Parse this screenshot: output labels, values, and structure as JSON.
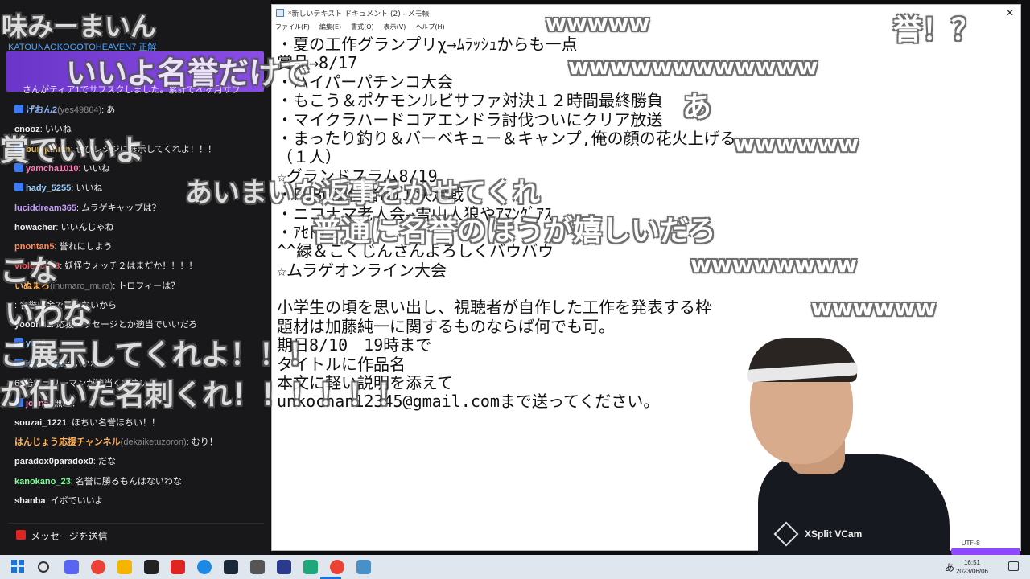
{
  "chat": {
    "top_name": "KATOUNAOKOGOTOHEAVEN7 正解",
    "sub_text": "さんがティア1でサブスクしました。累計で20ヶ月サブ",
    "messages": [
      {
        "user": "げおん2",
        "alt": "(yes49864)",
        "text": ": あ"
      },
      {
        "user": "cnooz",
        "alt": "",
        "text": ": いいね"
      },
      {
        "user": "bunijunian",
        "alt": "",
        "text": ": ぜひレシジに展示してくれよ！！！"
      },
      {
        "user": "yamcha1010",
        "alt": "",
        "text": ": いいね"
      },
      {
        "user": "hady_5255",
        "alt": "",
        "text": ": いいね"
      },
      {
        "user": "luciddream365",
        "alt": "",
        "text": ": ムラゲキャップは？"
      },
      {
        "user": "howacher",
        "alt": "",
        "text": ": いいんじゃね"
      },
      {
        "user": "pnontan5",
        "alt": "",
        "text": ": 誉れにしよう"
      },
      {
        "user": "violence63",
        "alt": "",
        "text": ": 妖怪ウォッチ２はまだか！！！！"
      },
      {
        "user": "いぬまろ",
        "alt": "(inumaro_mura)",
        "text": ": トロフィーは？"
      },
      {
        "user": "",
        "alt": "",
        "text": ": 名誉は金で買えないから"
      },
      {
        "user": "yooohh1",
        "alt": "",
        "text": ": 応援メッセージとか適当でいいだろ"
      },
      {
        "user": "yu",
        "alt": "",
        "text": "26"
      },
      {
        "user": "itaka_was",
        "alt": "",
        "text": ": いいね"
      },
      {
        "user": "",
        "alt": "",
        "text": "60倍サラリーマンが適当ください！"
      },
      {
        "user": "jolin5",
        "alt": "",
        "text": ": 無理！"
      },
      {
        "user": "souzai_1221",
        "alt": "",
        "text": ": ほちい名誉ほちい！！"
      },
      {
        "user": "はんじょう応援チャンネル",
        "alt": "(dekaiketuzoron)",
        "text": ": むり！"
      },
      {
        "user": "paradox0paradox0",
        "alt": "",
        "text": ": だな"
      },
      {
        "user": "kanokano_23",
        "alt": "",
        "text": ": 名誉に勝るもんはないわな"
      },
      {
        "user": "shanba",
        "alt": "",
        "text": ": イボでいいよ"
      }
    ],
    "send_label": "メッセージを送信"
  },
  "notepad": {
    "title": "*新しいテキスト ドキュメント (2) - メモ帳",
    "menus": [
      "ファイル(F)",
      "編集(E)",
      "書式(O)",
      "表示(V)",
      "ヘルプ(H)"
    ],
    "lines": [
      "・夏の工作グランプリχ→ﾑﾗｯｼｭからも一点",
      "賞品→8/17",
      "・ハイパーパチンコ大会",
      "・もこう＆ポケモンルビサファ対決１２時間最終勝負",
      "・マイクラハードコアエンドラ討伐ついにクリア放送",
      "・まったり釣り＆バーベキュー＆キャンプ,俺の顔の花火上げる",
      "（１人）",
      "☆グランドスラム8/19",
      "・PUBG配信者NO１決定戦",
      "・ニコナマ老人会→雪山人狼やｱﾏﾝｸﾞｱｽ",
      "・ｱｾﾄﾗ２",
      "^^緑＆こくじんさんよろしくバウバウ",
      "☆ムラゲオンライン大会",
      "",
      "小学生の頃を思い出し、視聴者が自作した工作を発表する枠",
      "題材は加藤純一に関するものならば何でも可。",
      "期日8/10　19時まで",
      "タイトルに作品名",
      "本文に軽い説明を添えて",
      "unkochan12345@gmail.comまで送ってください。"
    ],
    "status": "UTF-8"
  },
  "overlay_comments": [
    {
      "text": "味みーまいん",
      "size": 32
    },
    {
      "text": "いいよ名誉だけで",
      "size": 38
    },
    {
      "text": "wwwww",
      "size": 28
    },
    {
      "text": "誉！？",
      "size": 36
    },
    {
      "text": "wwwwwwwwwwww",
      "size": 28
    },
    {
      "text": "賞でいいよ",
      "size": 36
    },
    {
      "text": "あ",
      "size": 36
    },
    {
      "text": "wwwwww",
      "size": 28
    },
    {
      "text": "あいまいな返事をかせてくれ",
      "size": 34
    },
    {
      "text": "普通に名誉のほうが嬉しいだろ",
      "size": 36
    },
    {
      "text": "wwwwwwww",
      "size": 28
    },
    {
      "text": "こな",
      "size": 36
    },
    {
      "text": "いわな",
      "size": 36
    },
    {
      "text": "wwwwww",
      "size": 28
    },
    {
      "text": "こ展示してくれよ！！！",
      "size": 36
    },
    {
      "text": "が付いた名刺くれ！！！！！！",
      "size": 36
    }
  ],
  "webcam": {
    "label": "XSplit VCam"
  },
  "taskbar": {
    "ime": "あ",
    "time": "16:51",
    "date": "2023/06/06",
    "icons": [
      "start-icon",
      "search-icon",
      "discord-icon",
      "chrome-icon",
      "folder-icon",
      "app-icon",
      "red-app-icon",
      "blue-app-icon",
      "steam-icon",
      "ncv-icon",
      "monitor-icon",
      "green-app-icon",
      "chrome2-icon",
      "notepad-icon"
    ]
  }
}
